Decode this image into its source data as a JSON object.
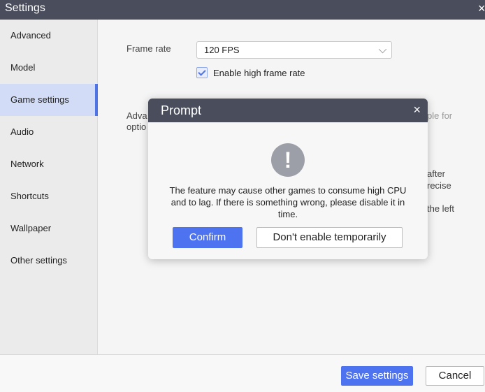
{
  "window": {
    "title": "Settings",
    "close_icon": "×"
  },
  "sidebar": {
    "items": [
      {
        "label": "Advanced",
        "active": false
      },
      {
        "label": "Model",
        "active": false
      },
      {
        "label": "Game settings",
        "active": true
      },
      {
        "label": "Audio",
        "active": false
      },
      {
        "label": "Network",
        "active": false
      },
      {
        "label": "Shortcuts",
        "active": false
      },
      {
        "label": "Wallpaper",
        "active": false
      },
      {
        "label": "Other settings",
        "active": false
      }
    ]
  },
  "game_settings": {
    "frame_rate_label": "Frame rate",
    "frame_rate_value": "120 FPS",
    "high_frame_rate_label": "Enable high frame rate",
    "high_frame_rate_checked": true,
    "obscured_text": {
      "adv_line1": "Adva",
      "adv_line2": "optio",
      "right_faded": "ple for",
      "right_line1": "after",
      "right_line2": "recise",
      "right_line3": "the left"
    }
  },
  "dialog": {
    "title": "Prompt",
    "close_icon": "×",
    "alert_icon": "!",
    "message": "The feature may cause other games to consume high CPU and to lag. If there is something wrong, please disable it in time.",
    "confirm_label": "Confirm",
    "decline_label": "Don't enable temporarily"
  },
  "footer": {
    "save_label": "Save settings",
    "cancel_label": "Cancel"
  },
  "colors": {
    "titlebar": "#4a4d5c",
    "accent": "#4e73f0",
    "active_item_bg": "#d3dcf7"
  }
}
